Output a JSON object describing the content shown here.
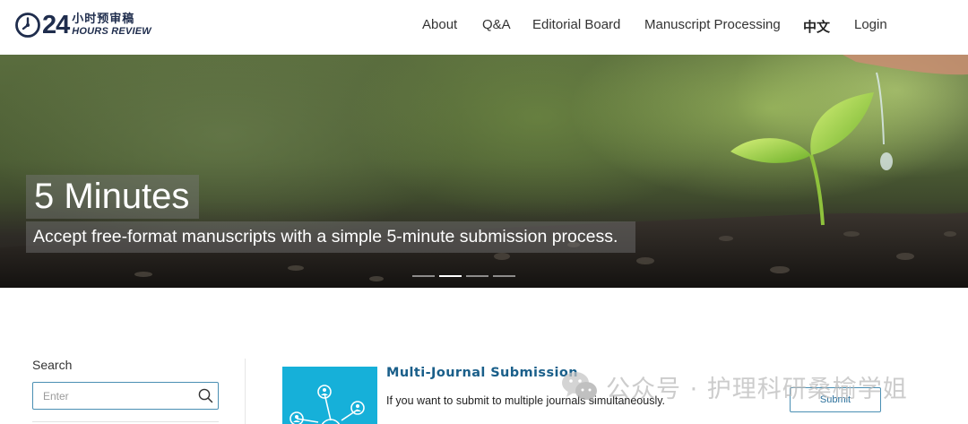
{
  "brand": {
    "logo_number": "24",
    "logo_cn": "小时预审稿",
    "logo_en": "HOURS REVIEW"
  },
  "nav": {
    "items": [
      {
        "label": "About"
      },
      {
        "label": "Q&A"
      },
      {
        "label": "Editorial Board"
      },
      {
        "label": "Manuscript Processing"
      },
      {
        "label": "中文"
      },
      {
        "label": "Login"
      }
    ]
  },
  "hero": {
    "title": "5 Minutes",
    "subtitle": "Accept free-format manuscripts with a simple 5-minute submission process.",
    "slides_total": 4,
    "active_slide": 2
  },
  "sidebar": {
    "search_label": "Search",
    "search_placeholder": "Enter",
    "search_value": ""
  },
  "feature": {
    "title": "Multi-Journal Submission",
    "description": "If you want to submit to multiple journals simultaneously.",
    "button_label": "Submit",
    "image_icon": "network-people-icon"
  },
  "watermark": {
    "icon": "wechat-icon",
    "text": "公众号 · 护理科研桑榆学姐"
  },
  "colors": {
    "brand_navy": "#1f2d4d",
    "accent_blue": "#4a8fb3",
    "link_blue": "#1a5f8a",
    "feature_cyan": "#16b0d9"
  }
}
